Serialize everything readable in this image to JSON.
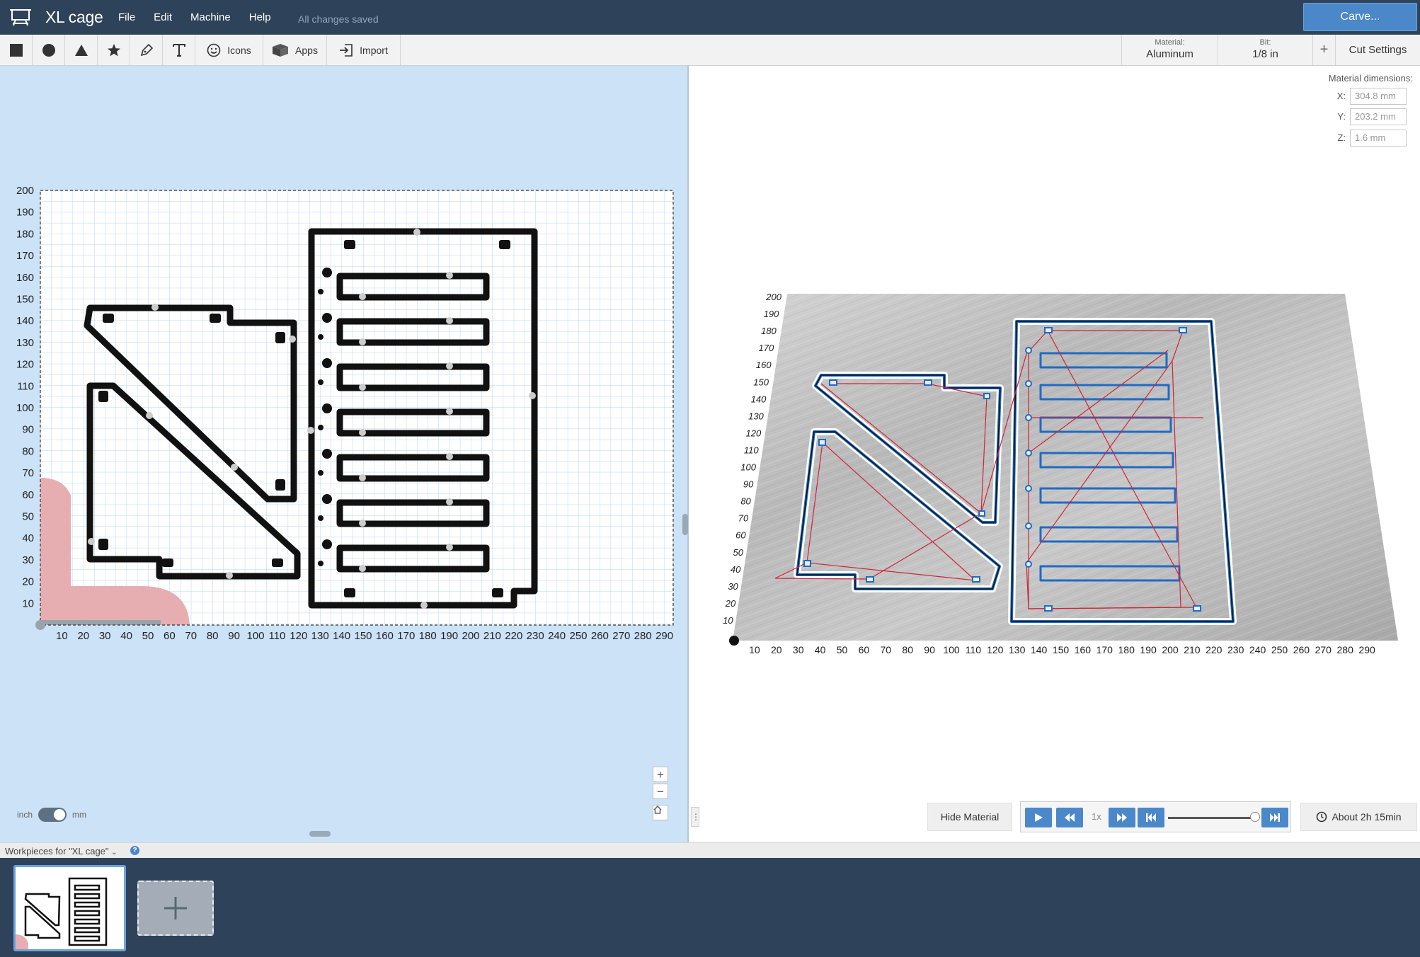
{
  "app": {
    "title": "XL cage",
    "menu": [
      "File",
      "Edit",
      "Machine",
      "Help"
    ],
    "save_status": "All changes saved",
    "carve_label": "Carve..."
  },
  "toolbar": {
    "shape_tools": [
      "square-icon",
      "circle-icon",
      "triangle-icon",
      "star-icon",
      "pen-icon",
      "text-icon"
    ],
    "icons_label": "Icons",
    "apps_label": "Apps",
    "import_label": "Import",
    "material_caption": "Material:",
    "material_value": "Aluminum",
    "bit_caption": "Bit:",
    "bit_value": "1/8 in",
    "add_symbol": "+",
    "cut_settings_label": "Cut Settings"
  },
  "design_canvas": {
    "y_ticks": [
      200,
      190,
      180,
      170,
      160,
      150,
      140,
      130,
      120,
      110,
      100,
      90,
      80,
      70,
      60,
      50,
      40,
      30,
      20,
      10
    ],
    "x_ticks": [
      10,
      20,
      30,
      40,
      50,
      60,
      70,
      80,
      90,
      100,
      110,
      120,
      130,
      140,
      150,
      160,
      170,
      180,
      190,
      200,
      210,
      220,
      230,
      240,
      250,
      260,
      270,
      280,
      290
    ],
    "unit_left": "inch",
    "unit_right": "mm",
    "zoom_in": "+",
    "zoom_out": "−",
    "home": "home-icon"
  },
  "material_dimensions": {
    "heading": "Material dimensions:",
    "x_label": "X:",
    "x_value": "304.8 mm",
    "y_label": "Y:",
    "y_value": "203.2 mm",
    "z_label": "Z:",
    "z_value": "1.6 mm"
  },
  "preview": {
    "y_ticks": [
      200,
      190,
      180,
      170,
      160,
      150,
      140,
      130,
      120,
      110,
      100,
      90,
      80,
      70,
      60,
      50,
      40,
      30,
      20,
      10
    ],
    "x_ticks": [
      10,
      20,
      30,
      40,
      50,
      60,
      70,
      80,
      90,
      100,
      110,
      120,
      130,
      140,
      150,
      160,
      170,
      180,
      190,
      200,
      210,
      220,
      230,
      240,
      250,
      260,
      270,
      280,
      290
    ]
  },
  "simulation": {
    "hide_material_label": "Hide Material",
    "speed_label": "1x",
    "progress": 1.0,
    "estimate_label": "About 2h 15min"
  },
  "workpieces": {
    "label": "Workpieces for \"XL cage\"",
    "help": "?"
  },
  "colors": {
    "header": "#2e4359",
    "accent": "#4a88c9",
    "canvas_bg": "#cbe2f7",
    "toolpath": "#d0233a",
    "cut_outline": "#1e6bc4"
  }
}
